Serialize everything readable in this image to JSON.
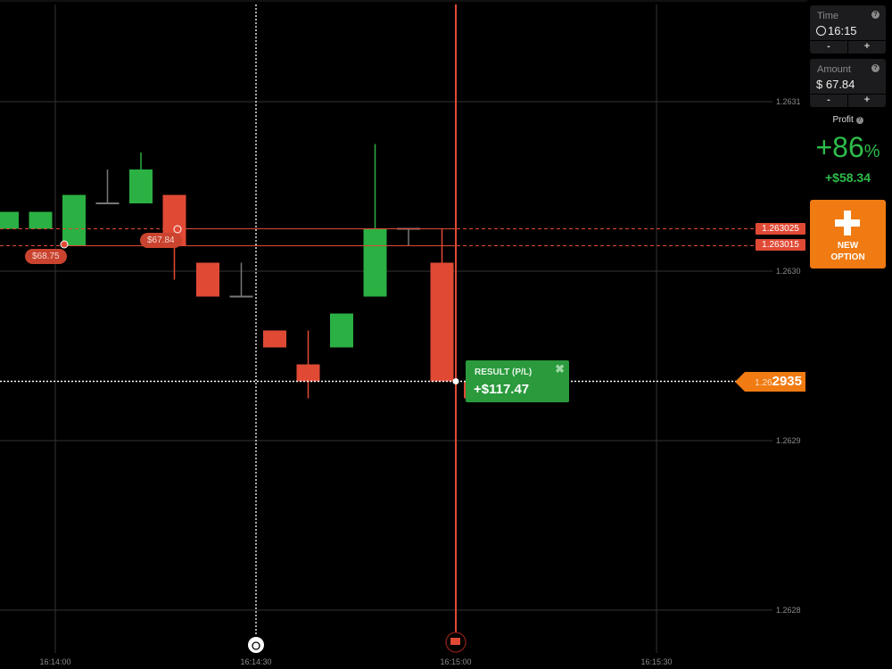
{
  "sidebar": {
    "time": {
      "label": "Time",
      "value": "16:15",
      "minus": "-",
      "plus": "+",
      "help": "?"
    },
    "amount": {
      "label": "Amount",
      "currency": "$",
      "value": "67.84",
      "minus": "-",
      "plus": "+",
      "help": "?"
    },
    "profit": {
      "label": "Profit",
      "help": "?",
      "percent": "+86",
      "percent_sign": "%",
      "amount": "+$58.34"
    },
    "new_option": {
      "line1": "NEW",
      "line2": "OPTION"
    }
  },
  "chart": {
    "y_labels": [
      "1.2631",
      "1.2630",
      "1.2629",
      "1.2628"
    ],
    "x_labels": [
      "16:14:00",
      "16:14:30",
      "16:15:00",
      "16:15:30"
    ],
    "strike_tags": [
      "1.263025",
      "1.263015"
    ],
    "current_price": {
      "prefix": "1.26",
      "suffix": "2935"
    },
    "deals": [
      "$68.75",
      "$67.84"
    ],
    "result": {
      "label": "RESULT (P/L)",
      "value": "+$117.47",
      "close": "✖"
    },
    "colors": {
      "up": "#2bb043",
      "down": "#e04a35",
      "accent": "#f07b12"
    }
  },
  "chart_data": {
    "type": "candlestick",
    "y_range": [
      1.26275,
      1.26315
    ],
    "x_range": [
      "16:13:59",
      "16:15:35"
    ],
    "y_ticks": [
      1.2628,
      1.2629,
      1.263,
      1.2631
    ],
    "x_ticks": [
      "16:14:00",
      "16:14:30",
      "16:15:00",
      "16:15:30"
    ],
    "candles": [
      {
        "open": 1.263025,
        "close": 1.263035,
        "high": 1.263035,
        "low": 1.263025
      },
      {
        "open": 1.263025,
        "close": 1.263035,
        "high": 1.263035,
        "low": 1.263025
      },
      {
        "open": 1.263015,
        "close": 1.263045,
        "high": 1.263045,
        "low": 1.263015
      },
      {
        "open": 1.26304,
        "close": 1.26304,
        "high": 1.26306,
        "low": 1.26304
      },
      {
        "open": 1.26304,
        "close": 1.26306,
        "high": 1.26307,
        "low": 1.26304
      },
      {
        "open": 1.263045,
        "close": 1.263015,
        "high": 1.263045,
        "low": 1.262995
      },
      {
        "open": 1.263005,
        "close": 1.262985,
        "high": 1.263005,
        "low": 1.262985
      },
      {
        "open": 1.262985,
        "close": 1.262985,
        "high": 1.263005,
        "low": 1.262985
      },
      {
        "open": 1.262965,
        "close": 1.262955,
        "high": 1.262965,
        "low": 1.262955
      },
      {
        "open": 1.262945,
        "close": 1.262935,
        "high": 1.262965,
        "low": 1.262925
      },
      {
        "open": 1.262955,
        "close": 1.262975,
        "high": 1.262975,
        "low": 1.262955
      },
      {
        "open": 1.262985,
        "close": 1.263025,
        "high": 1.263075,
        "low": 1.262985
      },
      {
        "open": 1.263025,
        "close": 1.263025,
        "high": 1.263025,
        "low": 1.263015
      },
      {
        "open": 1.263005,
        "close": 1.262935,
        "high": 1.263025,
        "low": 1.262935
      },
      {
        "open": 1.262935,
        "close": 1.262925,
        "high": 1.262935,
        "low": 1.262925
      }
    ],
    "current_price": 1.262935,
    "strike_prices": [
      1.263025,
      1.263015
    ],
    "annotations": [
      "$68.75",
      "$67.84",
      "RESULT (P/L) +$117.47"
    ]
  }
}
